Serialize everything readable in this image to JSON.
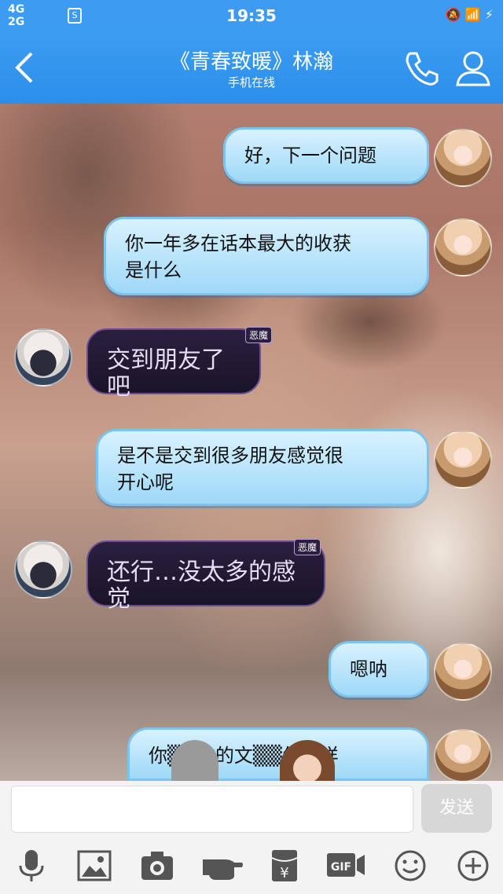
{
  "status": {
    "network_top": "4G",
    "network_bottom": "2G",
    "sim": "S",
    "time": "19:35",
    "right_icons": "🔕 📶 ⚡"
  },
  "header": {
    "title": "《青春致暖》林瀚",
    "subtitle": "手机在线"
  },
  "messages": [
    {
      "side": "right",
      "text_lines": [
        "好，下一个问题"
      ]
    },
    {
      "side": "right",
      "text_lines": [
        "你一年多在话本最大的收获",
        "是什么"
      ]
    },
    {
      "side": "left",
      "text": "交到朋友了吧",
      "tag": "恶魔"
    },
    {
      "side": "right",
      "text_lines": [
        "是不是交到很多朋友感觉很",
        "开心呢"
      ]
    },
    {
      "side": "left",
      "text": "还行…没太多的感觉",
      "tag": "恶魔"
    },
    {
      "side": "right",
      "text_lines": [
        "嗯呐"
      ]
    },
    {
      "side": "right",
      "text_lines": [
        "你▒▒你的文▒▒怎么样"
      ]
    }
  ],
  "input": {
    "placeholder": "",
    "send_label": "发送"
  },
  "toolbar": {
    "icons": [
      "mic-icon",
      "image-icon",
      "camera-icon",
      "poke-icon",
      "red-packet-icon",
      "gif-icon",
      "emoji-icon",
      "plus-icon"
    ],
    "gif_label": "GIF",
    "yuan": "¥"
  },
  "colors": {
    "header_blue": "#3d9cf2",
    "bubble_blue": "#bfe6fb",
    "dark_bubble": "#241a35"
  }
}
